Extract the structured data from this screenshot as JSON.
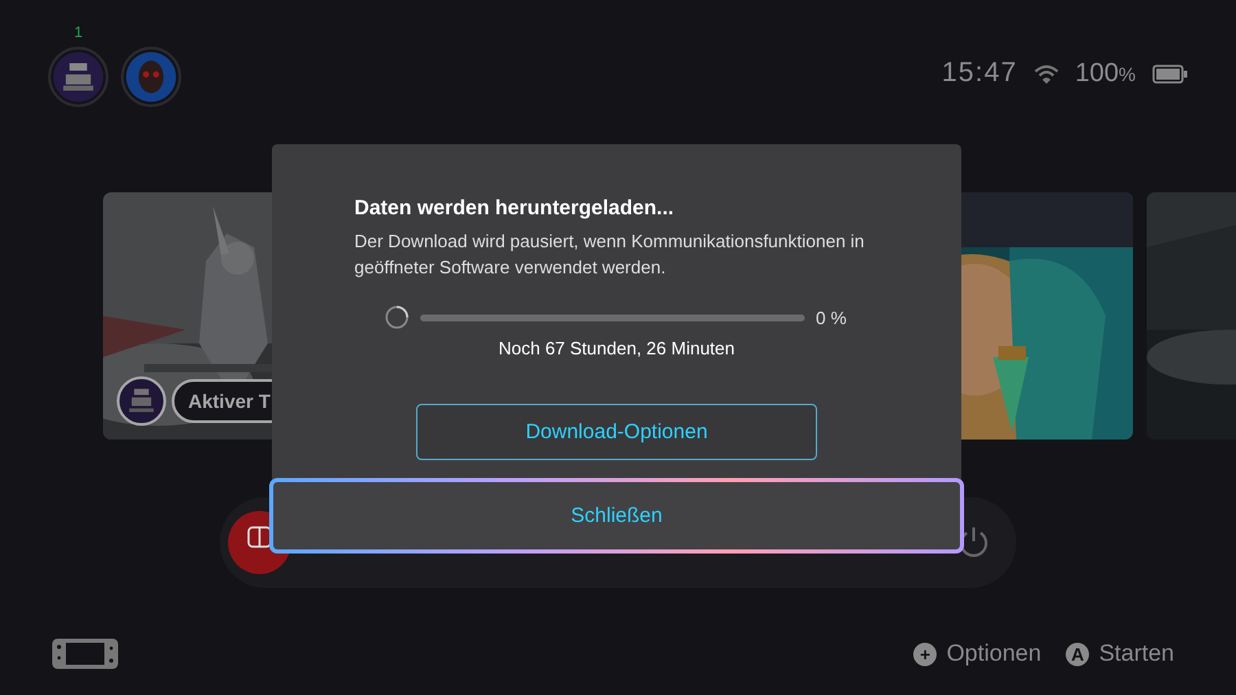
{
  "profile_badge": "1",
  "status": {
    "time": "15:47",
    "battery": "100",
    "battery_unit": "%"
  },
  "games": [
    {
      "kind": "picture",
      "status": "Aktiver T"
    },
    {
      "kind": "picture"
    },
    {
      "kind": "picture"
    }
  ],
  "dialog": {
    "title": "Daten werden heruntergeladen...",
    "message": "Der Download wird pausiert, wenn Kommunikationsfunktionen in geöffneter Software verwendet werden.",
    "progress": {
      "level": 0,
      "percent": "0 %",
      "remaining": "Noch 67 Stunden, 26 Minuten"
    },
    "buttons": [
      {
        "label": "Download-Optionen",
        "selected": false
      },
      {
        "label": "Schließen",
        "selected": true
      }
    ]
  },
  "hints": [
    {
      "glyph": "+",
      "label": "Optionen"
    },
    {
      "glyph": "A",
      "label": "Starten"
    }
  ]
}
